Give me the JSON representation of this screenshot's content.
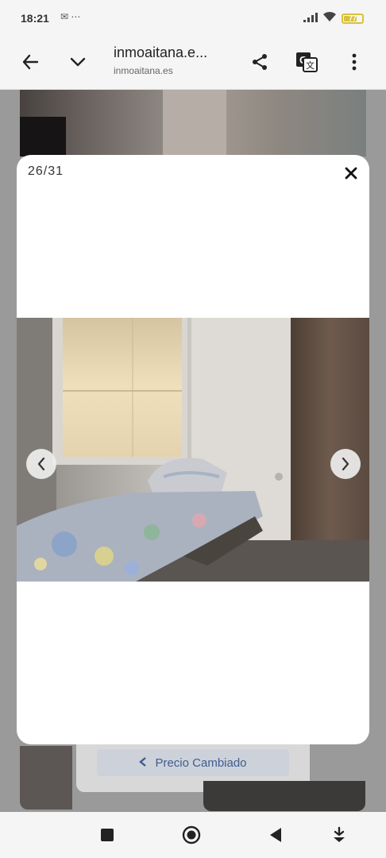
{
  "status_bar": {
    "time": "18:21",
    "left_icons": [
      "mail-icon",
      "more-dots-icon"
    ],
    "right_icons": [
      "signal-icon",
      "wifi-icon",
      "battery-icon"
    ],
    "battery_level": "77",
    "battery_color": "#d8c23a"
  },
  "browser": {
    "title": "inmoaitana.e...",
    "domain": "inmoaitana.es",
    "icons": [
      "back-arrow-icon",
      "chevron-down-icon",
      "share-icon",
      "translate-icon",
      "more-vertical-icon"
    ]
  },
  "gallery": {
    "counter": "26/31",
    "close_icon": "close-icon",
    "prev_icon": "chevron-left-icon",
    "next_icon": "chevron-right-icon"
  },
  "background_page": {
    "badge_icon": "chevron-left-icon",
    "badge_text": "Precio Cambiado",
    "badge_color": "#3f5c8e"
  },
  "system_nav": {
    "icons": [
      "square-icon",
      "home-circle-icon",
      "back-triangle-icon",
      "download-arrow-icon"
    ]
  }
}
